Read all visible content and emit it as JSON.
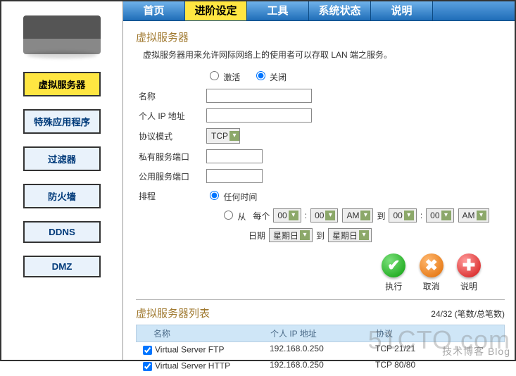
{
  "tabs": {
    "home": "首页",
    "advanced": "进阶设定",
    "tools": "工具",
    "status": "系统状态",
    "help": "说明"
  },
  "sidebar": {
    "items": [
      {
        "label": "虚拟服务器"
      },
      {
        "label": "特殊应用程序"
      },
      {
        "label": "过滤器"
      },
      {
        "label": "防火墙"
      },
      {
        "label": "DDNS"
      },
      {
        "label": "DMZ"
      }
    ]
  },
  "section": {
    "title": "虚拟服务器",
    "desc": "虚拟服务器用来允许网际网络上的使用者可以存取 LAN 端之服务。"
  },
  "form": {
    "enable_label": "激活",
    "disable_label": "关闭",
    "name_label": "名称",
    "ip_label": "个人 IP 地址",
    "proto_label": "协议模式",
    "proto_value": "TCP",
    "private_port_label": "私有服务端口",
    "public_port_label": "公用服务端口",
    "schedule_label": "排程",
    "sched_any": "任何时间",
    "sched_from": "从",
    "sched_every": "每个",
    "sched_hour1": "00",
    "sched_min1": "00",
    "sched_ampm1": "AM",
    "sched_to": "到",
    "sched_hour2": "00",
    "sched_min2": "00",
    "sched_ampm2": "AM",
    "sched_date": "日期",
    "sched_day1": "星期日",
    "sched_day2": "星期日"
  },
  "actions": {
    "apply": "执行",
    "cancel": "取消",
    "help": "说明"
  },
  "list": {
    "title": "虚拟服务器列表",
    "count": "24/32 (笔数/总笔数)",
    "headers": {
      "name": "名称",
      "ip": "个人 IP 地址",
      "proto": "协议"
    },
    "rows": [
      {
        "checked": true,
        "name": "Virtual Server FTP",
        "ip": "192.168.0.250",
        "proto": "TCP 21/21"
      },
      {
        "checked": true,
        "name": "Virtual Server HTTP",
        "ip": "192.168.0.250",
        "proto": "TCP 80/80"
      }
    ]
  },
  "watermark": {
    "main": "51CTO.com",
    "sub": "技术博客 Blog"
  }
}
